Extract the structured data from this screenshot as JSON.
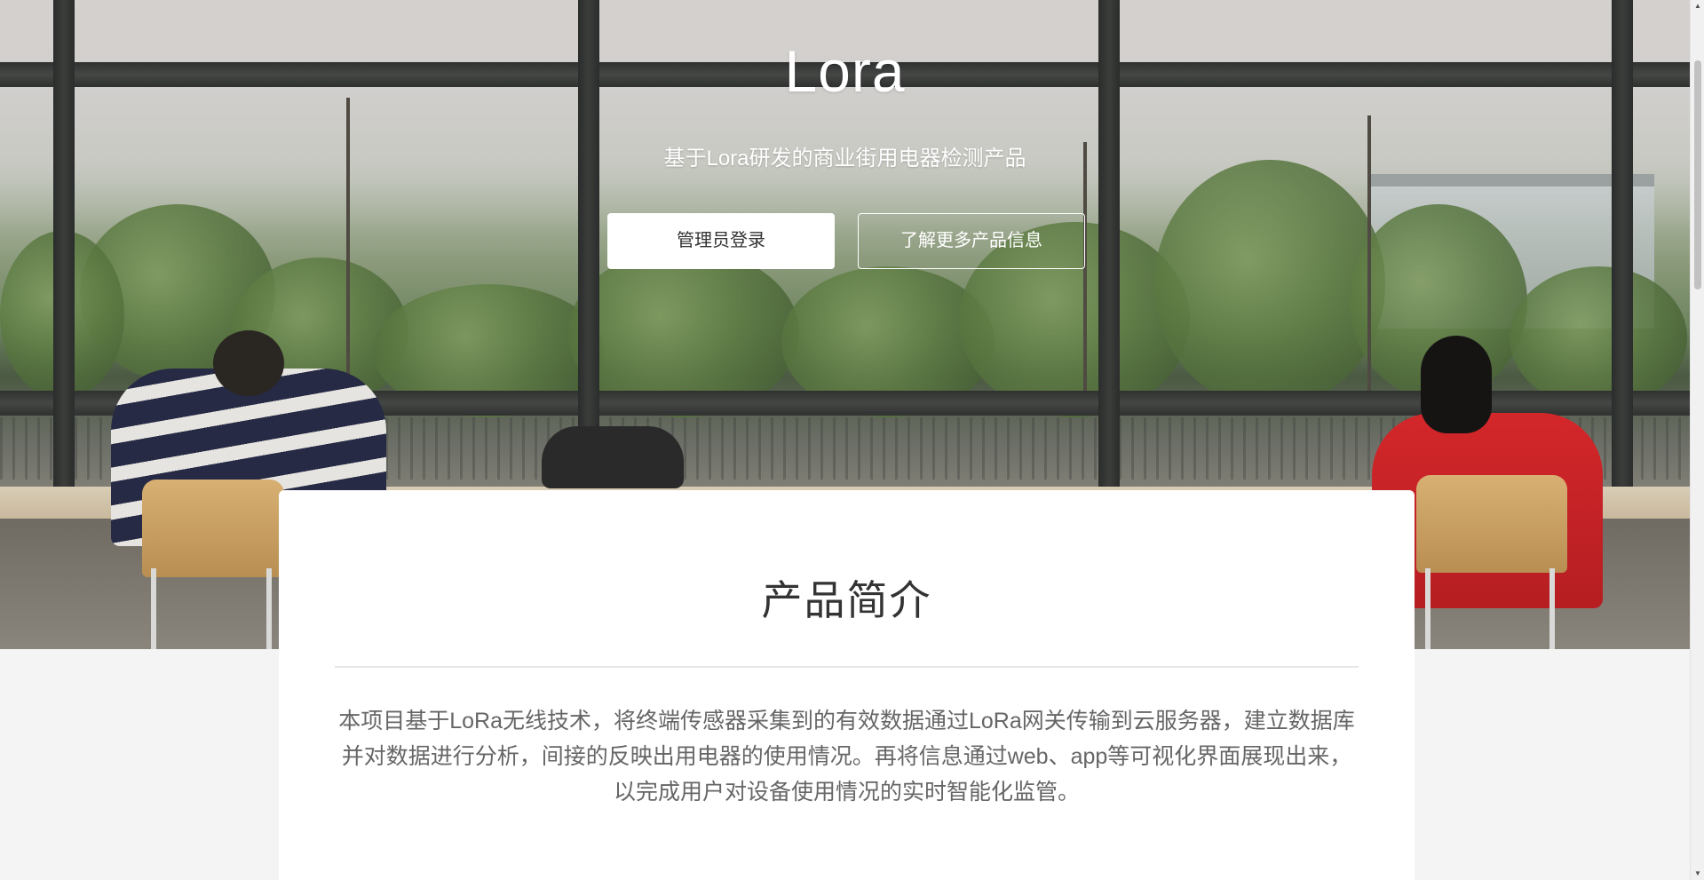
{
  "hero": {
    "title": "Lora",
    "subtitle": "基于Lora研发的商业街用电器检测产品",
    "buttons": {
      "login": "管理员登录",
      "learn_more": "了解更多产品信息"
    }
  },
  "intro": {
    "title": "产品简介",
    "body": "本项目基于LoRa无线技术，将终端传感器采集到的有效数据通过LoRa网关传输到云服务器，建立数据库并对数据进行分析，间接的反映出用电器的使用情况。再将信息通过web、app等可视化界面展现出来，以完成用户对设备使用情况的实时智能化监管。"
  },
  "scrollbar": {
    "up_icon": "triangle-up-icon",
    "down_icon": "triangle-down-icon"
  },
  "colors": {
    "page_background": "#f4f4f4",
    "card_background": "#ffffff",
    "title_text": "#333333",
    "body_text": "#666666",
    "hero_text": "#ffffff"
  }
}
